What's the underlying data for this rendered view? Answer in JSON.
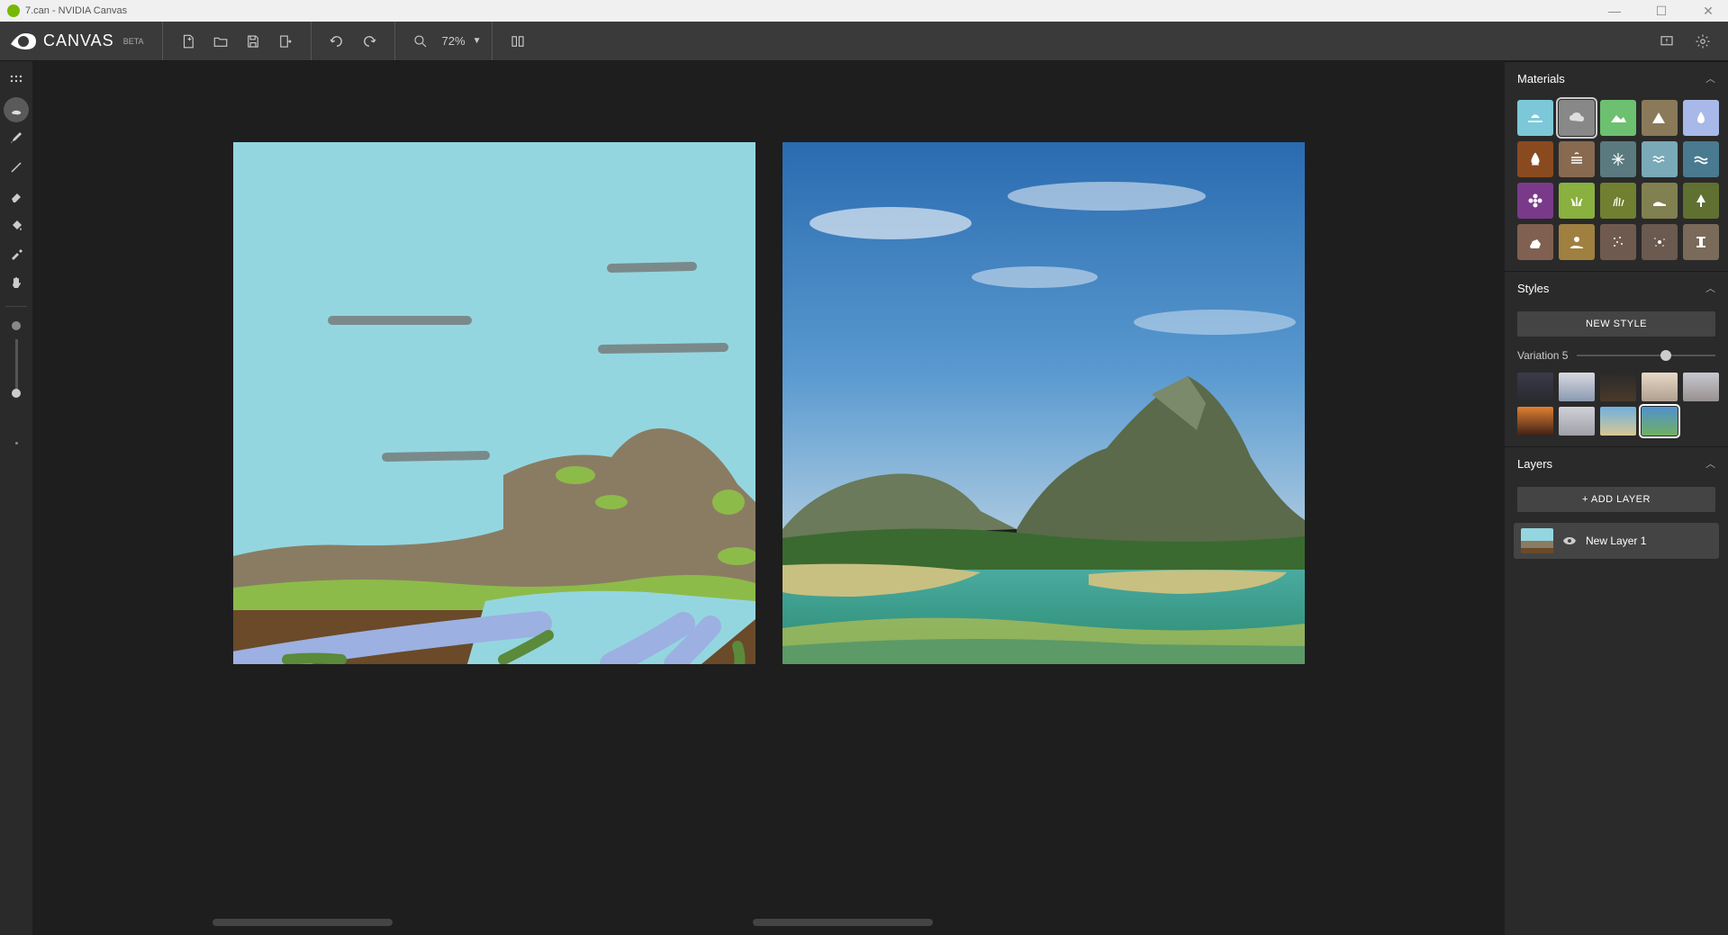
{
  "window": {
    "title": "7.can - NVIDIA Canvas"
  },
  "app": {
    "name": "CANVAS",
    "badge": "BETA"
  },
  "zoom": {
    "value": "72%"
  },
  "panels": {
    "materials_title": "Materials",
    "styles_title": "Styles",
    "layers_title": "Layers",
    "new_style_btn": "NEW STYLE",
    "add_layer_btn": "+ ADD LAYER",
    "variation_label": "Variation 5"
  },
  "materials": [
    {
      "name": "sky",
      "color": "#7cc8d8"
    },
    {
      "name": "cloud",
      "color": "#888888",
      "selected": true
    },
    {
      "name": "hill",
      "color": "#6cc070"
    },
    {
      "name": "mountain",
      "color": "#8a7a5a"
    },
    {
      "name": "water",
      "color": "#a8b8e8"
    },
    {
      "name": "fire",
      "color": "#8a4a20"
    },
    {
      "name": "fog",
      "color": "#886a50"
    },
    {
      "name": "snow",
      "color": "#5a7a80"
    },
    {
      "name": "waves",
      "color": "#7aaab8"
    },
    {
      "name": "sea",
      "color": "#4a7a90"
    },
    {
      "name": "flower",
      "color": "#7a3a8a"
    },
    {
      "name": "grass",
      "color": "#8ab040"
    },
    {
      "name": "bush",
      "color": "#708030"
    },
    {
      "name": "dirt",
      "color": "#808050"
    },
    {
      "name": "tree",
      "color": "#607030"
    },
    {
      "name": "rock",
      "color": "#806050"
    },
    {
      "name": "sand",
      "color": "#a08040"
    },
    {
      "name": "gravel",
      "color": "#705a50"
    },
    {
      "name": "stars",
      "color": "#6a5a50"
    },
    {
      "name": "stone",
      "color": "#7a6a5a"
    }
  ],
  "styles": [
    {
      "name": "style-1"
    },
    {
      "name": "style-2"
    },
    {
      "name": "style-3"
    },
    {
      "name": "style-4"
    },
    {
      "name": "style-5"
    },
    {
      "name": "style-6"
    },
    {
      "name": "style-7"
    },
    {
      "name": "style-8"
    },
    {
      "name": "style-9",
      "selected": true
    }
  ],
  "style_thumbs_css": [
    "linear-gradient(#3a3a4a,#2a2a30)",
    "linear-gradient(#d8d8e0,#8a9ab0)",
    "linear-gradient(#2a2a2a,#4a3a2a)",
    "linear-gradient(#e8d8c8,#b0a090)",
    "linear-gradient(#c8c8d0,#989090)",
    "linear-gradient(#e08030,#402018)",
    "linear-gradient(#d0d0d8,#a0a0a8)",
    "linear-gradient(#70b0e0,#d8c890)",
    "linear-gradient(#5090d0,#70b060)"
  ],
  "layers": [
    {
      "name": "New Layer 1"
    }
  ]
}
